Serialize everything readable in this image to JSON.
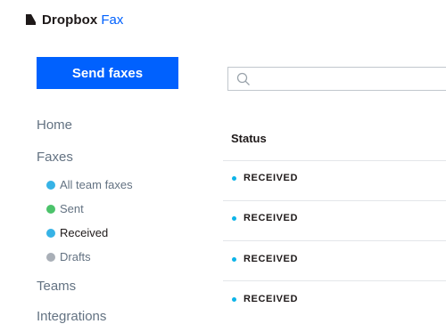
{
  "header": {
    "brand": "Dropbox",
    "product": "Fax",
    "brand_color": "#0061FE"
  },
  "sidebar": {
    "send_button": "Send faxes",
    "home": "Home",
    "faxes": "Faxes",
    "fax_items": [
      {
        "label": "All team faxes",
        "dot_color": "#37B3E6"
      },
      {
        "label": "Sent",
        "dot_color": "#4CC36B"
      },
      {
        "label": "Received",
        "dot_color": "#37B3E6",
        "active": true
      },
      {
        "label": "Drafts",
        "dot_color": "#A9AFB7"
      }
    ],
    "teams": "Teams",
    "integrations": "Integrations"
  },
  "search": {
    "placeholder": "",
    "value": ""
  },
  "table": {
    "column_header": "Status",
    "rows": [
      {
        "status": "RECEIVED"
      },
      {
        "status": "RECEIVED"
      },
      {
        "status": "RECEIVED"
      },
      {
        "status": "RECEIVED"
      }
    ],
    "status_dot_color": "#0DB4E8"
  }
}
